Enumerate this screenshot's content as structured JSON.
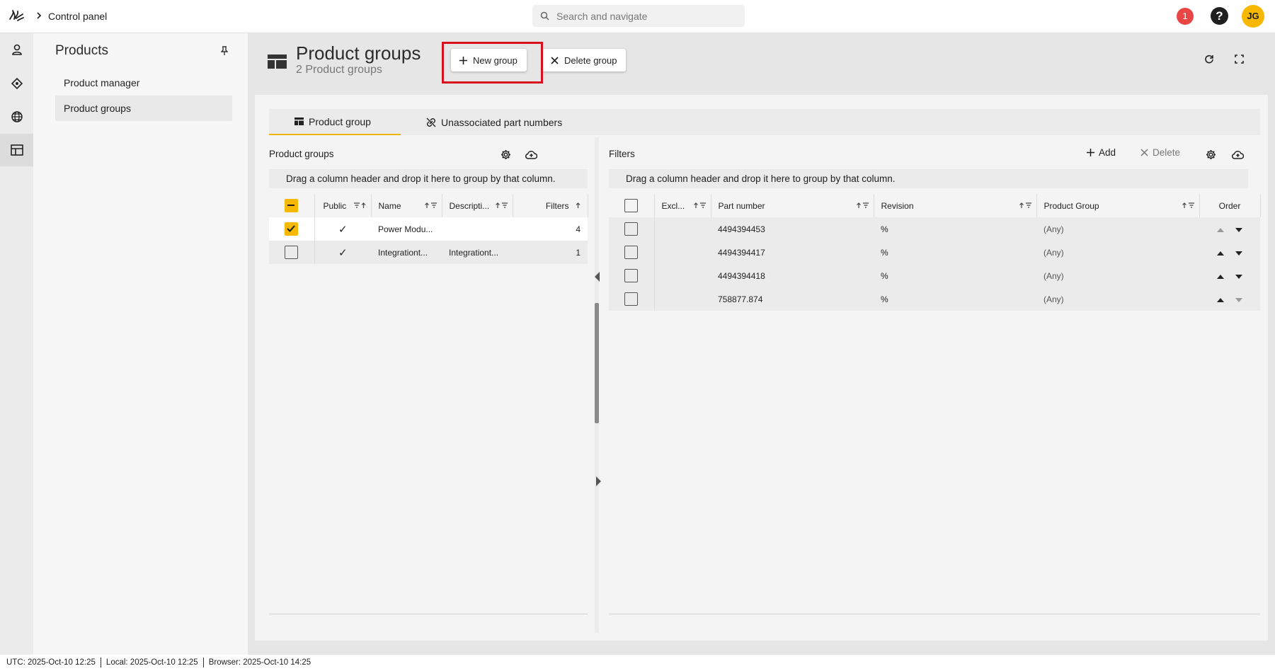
{
  "header": {
    "breadcrumb": "Control panel",
    "search_placeholder": "Search and navigate",
    "notification_count": "1",
    "help_label": "?",
    "avatar_initials": "JG"
  },
  "sidenav": {
    "title": "Products",
    "items": [
      {
        "label": "Product manager",
        "active": false
      },
      {
        "label": "Product groups",
        "active": true
      }
    ]
  },
  "page": {
    "title": "Product groups",
    "subtitle": "2 Product groups",
    "new_group_label": "New group",
    "delete_group_label": "Delete group"
  },
  "tabs": [
    {
      "label": "Product group",
      "active": true
    },
    {
      "label": "Unassociated part numbers",
      "active": false
    }
  ],
  "left_panel": {
    "title": "Product groups",
    "drop_hint": "Drag a column header and drop it here to group by that column.",
    "columns": [
      "Public",
      "Name",
      "Descripti...",
      "Filters"
    ],
    "rows": [
      {
        "checked": true,
        "public": "✓",
        "name": "Power Modu...",
        "description": "",
        "filters": "4"
      },
      {
        "checked": false,
        "public": "✓",
        "name": "Integrationt...",
        "description": "Integrationt...",
        "filters": "1"
      }
    ]
  },
  "right_panel": {
    "title": "Filters",
    "add_label": "Add",
    "delete_label": "Delete",
    "drop_hint": "Drag a column header and drop it here to group by that column.",
    "columns": [
      "Excl...",
      "Part number",
      "Revision",
      "Product Group",
      "Order"
    ],
    "rows": [
      {
        "part_number": "4494394453",
        "revision": "%",
        "product_group": "(Any)"
      },
      {
        "part_number": "4494394417",
        "revision": "%",
        "product_group": "(Any)"
      },
      {
        "part_number": "4494394418",
        "revision": "%",
        "product_group": "(Any)"
      },
      {
        "part_number": "758877.874",
        "revision": "%",
        "product_group": "(Any)"
      }
    ]
  },
  "status_bar": {
    "utc": "UTC: 2025-Oct-10 12:25",
    "local": "Local: 2025-Oct-10 12:25",
    "browser": "Browser: 2025-Oct-10 14:25"
  },
  "colors": {
    "accent": "#f6b800",
    "highlight_box": "#d9101e",
    "notification": "#e94545"
  }
}
